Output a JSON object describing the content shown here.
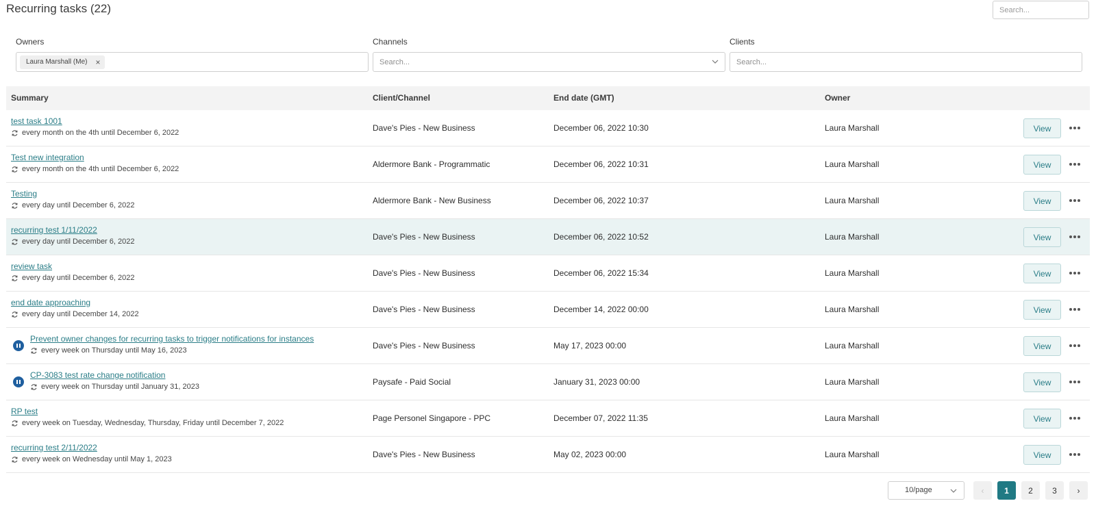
{
  "header": {
    "title": "Recurring tasks (22)",
    "search_placeholder": "Search..."
  },
  "filters": {
    "owners": {
      "label": "Owners",
      "chip": "Laura Marshall (Me)"
    },
    "channels": {
      "label": "Channels",
      "placeholder": "Search..."
    },
    "clients": {
      "label": "Clients",
      "placeholder": "Search..."
    }
  },
  "table": {
    "headers": {
      "summary": "Summary",
      "client": "Client/Channel",
      "end_date": "End date (GMT)",
      "owner": "Owner"
    },
    "view_label": "View",
    "rows": [
      {
        "title": "test task 1001",
        "recurrence": "every month on the 4th until December 6, 2022",
        "client": "Dave's Pies - New Business",
        "end_date": "December 06, 2022 10:30",
        "owner": "Laura Marshall",
        "paused": false
      },
      {
        "title": "Test new integration",
        "recurrence": "every month on the 4th until December 6, 2022",
        "client": "Aldermore Bank - Programmatic",
        "end_date": "December 06, 2022 10:31",
        "owner": "Laura Marshall",
        "paused": false
      },
      {
        "title": "Testing",
        "recurrence": "every day until December 6, 2022",
        "client": "Aldermore Bank - New Business",
        "end_date": "December 06, 2022 10:37",
        "owner": "Laura Marshall",
        "paused": false
      },
      {
        "title": "recurring test 1/11/2022",
        "recurrence": "every day until December 6, 2022",
        "client": "Dave's Pies - New Business",
        "end_date": "December 06, 2022 10:52",
        "owner": "Laura Marshall",
        "paused": false
      },
      {
        "title": "review task",
        "recurrence": "every day until December 6, 2022",
        "client": "Dave's Pies - New Business",
        "end_date": "December 06, 2022 15:34",
        "owner": "Laura Marshall",
        "paused": false
      },
      {
        "title": "end date approaching",
        "recurrence": "every day until December 14, 2022",
        "client": "Dave's Pies - New Business",
        "end_date": "December 14, 2022 00:00",
        "owner": "Laura Marshall",
        "paused": false
      },
      {
        "title": "Prevent owner changes for recurring tasks to trigger notifications for instances",
        "recurrence": "every week on Thursday until May 16, 2023",
        "client": "Dave's Pies - New Business",
        "end_date": "May 17, 2023 00:00",
        "owner": "Laura Marshall",
        "paused": true
      },
      {
        "title": "CP-3083 test rate change notification",
        "recurrence": "every week on Thursday until January 31, 2023",
        "client": "Paysafe - Paid Social",
        "end_date": "January 31, 2023 00:00",
        "owner": "Laura Marshall",
        "paused": true
      },
      {
        "title": "RP test",
        "recurrence": "every week on Tuesday, Wednesday, Thursday, Friday until December 7, 2022",
        "client": "Page Personel Singapore - PPC",
        "end_date": "December 07, 2022 11:35",
        "owner": "Laura Marshall",
        "paused": false
      },
      {
        "title": "recurring test 2/11/2022",
        "recurrence": "every week on Wednesday until May 1, 2023",
        "client": "Dave's Pies - New Business",
        "end_date": "May 02, 2023 00:00",
        "owner": "Laura Marshall",
        "paused": false
      }
    ]
  },
  "pagination": {
    "page_size": "10/page",
    "prev_icon": "chevron-left-icon",
    "next_icon": "chevron-right-icon",
    "pages": [
      "1",
      "2",
      "3"
    ],
    "current_page": 1
  },
  "colors": {
    "accent": "#207a84",
    "link": "#2a7d87",
    "highlight_row": "#eaf3f3",
    "paused_badge": "#1f5f9f"
  }
}
